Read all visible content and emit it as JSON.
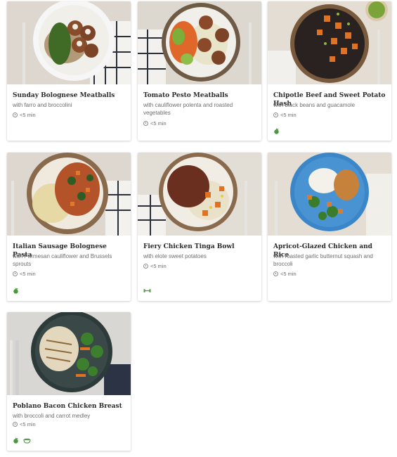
{
  "meals": [
    {
      "title": "Sunday Bolognese Meatballs",
      "subtitle": "with farro and broccolini",
      "time": "<5 min",
      "tags": []
    },
    {
      "title": "Tomato Pesto Meatballs",
      "subtitle": "with cauliflower polenta and roasted vegetables",
      "time": "<5 min",
      "tags": []
    },
    {
      "title": "Chipotle Beef and Sweet Potato Hash",
      "subtitle": "with black beans and guacamole",
      "time": "<5 min",
      "tags": [
        "apple-icon"
      ]
    },
    {
      "title": "Italian Sausage Bolognese Pasta",
      "subtitle": "with Parmesan cauliflower and Brussels sprouts",
      "time": "<5 min",
      "tags": [
        "apple-icon"
      ]
    },
    {
      "title": "Fiery Chicken Tinga Bowl",
      "subtitle": "with elote sweet potatoes",
      "time": "<5 min",
      "tags": [
        "dumbbell-icon"
      ]
    },
    {
      "title": "Apricot-Glazed Chicken and Rice",
      "subtitle": "with roasted garlic butternut squash and broccoli",
      "time": "<5 min",
      "tags": []
    },
    {
      "title": "Poblano Bacon Chicken Breast",
      "subtitle": "with broccoli and carrot medley",
      "time": "<5 min",
      "tags": [
        "apple-icon",
        "bowl-icon"
      ]
    }
  ],
  "colors": {
    "tag_green": "#4a9a3c"
  }
}
